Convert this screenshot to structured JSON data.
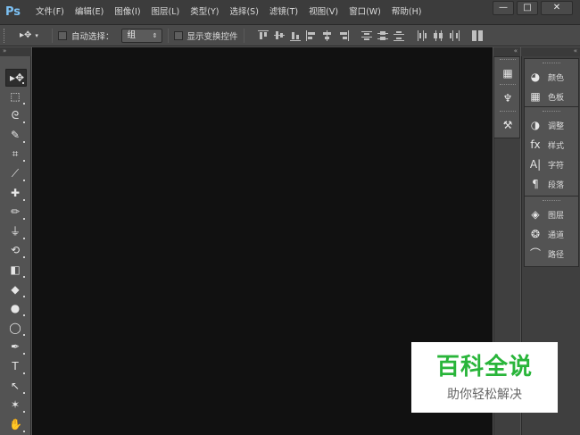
{
  "app": {
    "logo_text": "Ps",
    "menu": [
      "文件(F)",
      "编辑(E)",
      "图像(I)",
      "图层(L)",
      "类型(Y)",
      "选择(S)",
      "滤镜(T)",
      "视图(V)",
      "窗口(W)",
      "帮助(H)"
    ],
    "window_controls": {
      "minimize": "—",
      "restore": "□",
      "close": "✕"
    }
  },
  "options_bar": {
    "preset_glyph": "▸✥",
    "preset_arrow": "▾",
    "auto_select_label": "自动选择：",
    "auto_select_value": "组",
    "auto_select_arrow": "⇕",
    "show_transform_label": "显示变换控件"
  },
  "panel_collapse_glyphs": {
    "left": "»",
    "icons": "«",
    "named": "«"
  },
  "tools": [
    {
      "name": "move-tool",
      "glyph": "▸✥",
      "active": true
    },
    {
      "name": "marquee-tool",
      "glyph": "⬚"
    },
    {
      "name": "lasso-tool",
      "glyph": "ᘓ"
    },
    {
      "name": "quick-select-tool",
      "glyph": "✎"
    },
    {
      "name": "crop-tool",
      "glyph": "⌗"
    },
    {
      "name": "eyedropper-tool",
      "glyph": "⟋"
    },
    {
      "name": "healing-brush-tool",
      "glyph": "✚"
    },
    {
      "name": "brush-tool",
      "glyph": "✏"
    },
    {
      "name": "clone-stamp-tool",
      "glyph": "⏚"
    },
    {
      "name": "history-brush-tool",
      "glyph": "⟲"
    },
    {
      "name": "eraser-tool",
      "glyph": "◧"
    },
    {
      "name": "paint-bucket-tool",
      "glyph": "◆"
    },
    {
      "name": "blur-tool",
      "glyph": "●"
    },
    {
      "name": "dodge-tool",
      "glyph": "◯"
    },
    {
      "name": "pen-tool",
      "glyph": "✒"
    },
    {
      "name": "type-tool",
      "glyph": "T"
    },
    {
      "name": "path-select-tool",
      "glyph": "↖"
    },
    {
      "name": "shape-tool",
      "glyph": "✶"
    },
    {
      "name": "hand-tool",
      "glyph": "✋"
    }
  ],
  "icon_panel": [
    {
      "name": "history-icon",
      "glyph": "▦"
    },
    {
      "name": "brush-presets-icon",
      "glyph": "♆"
    },
    {
      "name": "tool-presets-icon",
      "glyph": "⚒"
    }
  ],
  "named_panels": [
    {
      "group": "color",
      "items": [
        {
          "icon": "palette-icon",
          "glyph": "◕",
          "label": "颜色"
        },
        {
          "icon": "swatches-icon",
          "glyph": "▦",
          "label": "色板"
        }
      ]
    },
    {
      "group": "adjust",
      "items": [
        {
          "icon": "adjustments-icon",
          "glyph": "◑",
          "label": "调整"
        },
        {
          "icon": "styles-icon",
          "glyph": "fx",
          "label": "样式"
        },
        {
          "icon": "character-icon",
          "glyph": "A|",
          "label": "字符"
        },
        {
          "icon": "paragraph-icon",
          "glyph": "¶",
          "label": "段落"
        }
      ]
    },
    {
      "group": "layers",
      "items": [
        {
          "icon": "layers-icon",
          "glyph": "◈",
          "label": "图层"
        },
        {
          "icon": "channels-icon",
          "glyph": "❂",
          "label": "通道"
        },
        {
          "icon": "paths-icon",
          "glyph": "⌒",
          "label": "路径"
        }
      ]
    }
  ],
  "watermark": {
    "title": "百科全说",
    "subtitle": "助你轻松解决"
  },
  "colors": {
    "canvas": "#111111",
    "chrome": "#535353",
    "logo": "#7cc1f4",
    "watermark_green": "#29b53a"
  }
}
